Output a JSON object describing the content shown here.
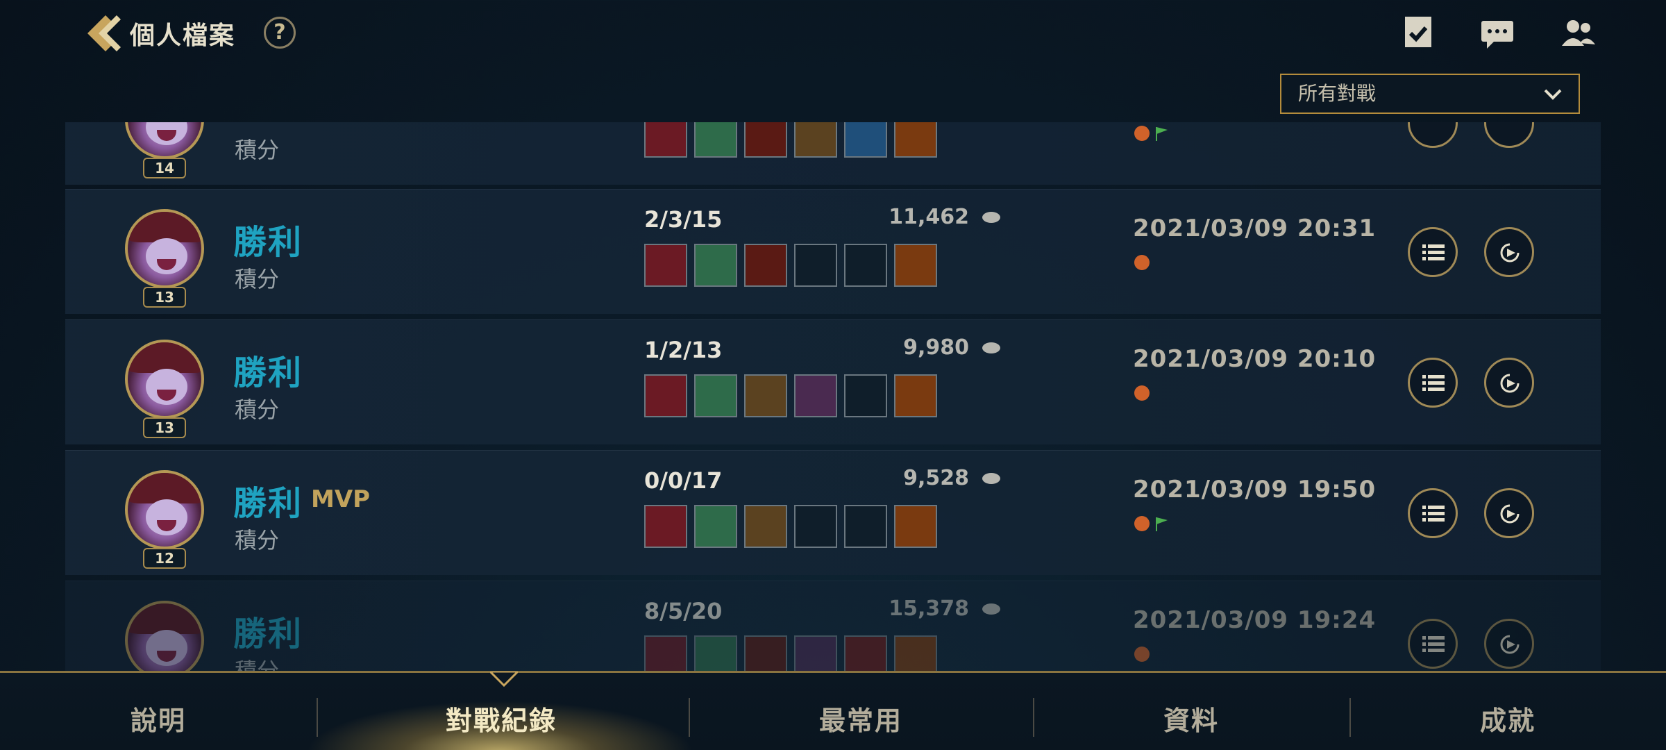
{
  "header": {
    "title": "個人檔案",
    "help_label": "?",
    "filter_value": "所有對戰"
  },
  "matches": [
    {
      "level": "14",
      "result": "",
      "mvp": "",
      "mode": "積分",
      "kda": "",
      "gold": "",
      "date": "",
      "tags": [
        "rank-icon",
        "flag-icon"
      ],
      "items": [
        "red-armor-item",
        "green-gem-item",
        "red-chalice-item",
        "cloak-item",
        "blue-compass-item",
        "orange-wing-item"
      ],
      "partial": "top"
    },
    {
      "level": "13",
      "result": "勝利",
      "mvp": "",
      "mode": "積分",
      "kda": "2/3/15",
      "gold": "11,462",
      "date": "2021/03/09 20:31",
      "tags": [
        "rank-icon"
      ],
      "items": [
        "red-armor-item",
        "green-gem-item",
        "red-chalice-item",
        "empty-slot",
        "empty-slot",
        "orange-wing-item"
      ],
      "partial": ""
    },
    {
      "level": "13",
      "result": "勝利",
      "mvp": "",
      "mode": "積分",
      "kda": "1/2/13",
      "gold": "9,980",
      "date": "2021/03/09 20:10",
      "tags": [
        "rank-icon"
      ],
      "items": [
        "red-armor-item",
        "green-gem-item",
        "cloak-item",
        "purple-tome-item",
        "empty-slot",
        "orange-wing-item"
      ],
      "partial": ""
    },
    {
      "level": "12",
      "result": "勝利",
      "mvp": "MVP",
      "mode": "積分",
      "kda": "0/0/17",
      "gold": "9,528",
      "date": "2021/03/09 19:50",
      "tags": [
        "rank-icon",
        "flag-icon"
      ],
      "items": [
        "red-armor-item",
        "green-gem-item",
        "cloak-item",
        "empty-slot",
        "empty-slot",
        "orange-wing-item"
      ],
      "partial": ""
    },
    {
      "level": "",
      "result": "勝利",
      "mvp": "",
      "mode": "積分",
      "kda": "8/5/20",
      "gold": "15,378",
      "date": "2021/03/09 19:24",
      "tags": [
        "rank-icon"
      ],
      "items": [
        "red-armor-item",
        "green-gem-item",
        "red-chalice-item",
        "purple-tome-item",
        "red-orb-item",
        "orange-wing-item"
      ],
      "partial": "bottom"
    }
  ],
  "tabs": [
    {
      "label": "說明",
      "active": false
    },
    {
      "label": "對戰紀錄",
      "active": true
    },
    {
      "label": "最常用",
      "active": false
    },
    {
      "label": "資料",
      "active": false
    },
    {
      "label": "成就",
      "active": false
    }
  ],
  "colors": {
    "victory": "#1fa3c1",
    "gold_accent": "#b48c3c",
    "mvp": "#c2a35c"
  }
}
